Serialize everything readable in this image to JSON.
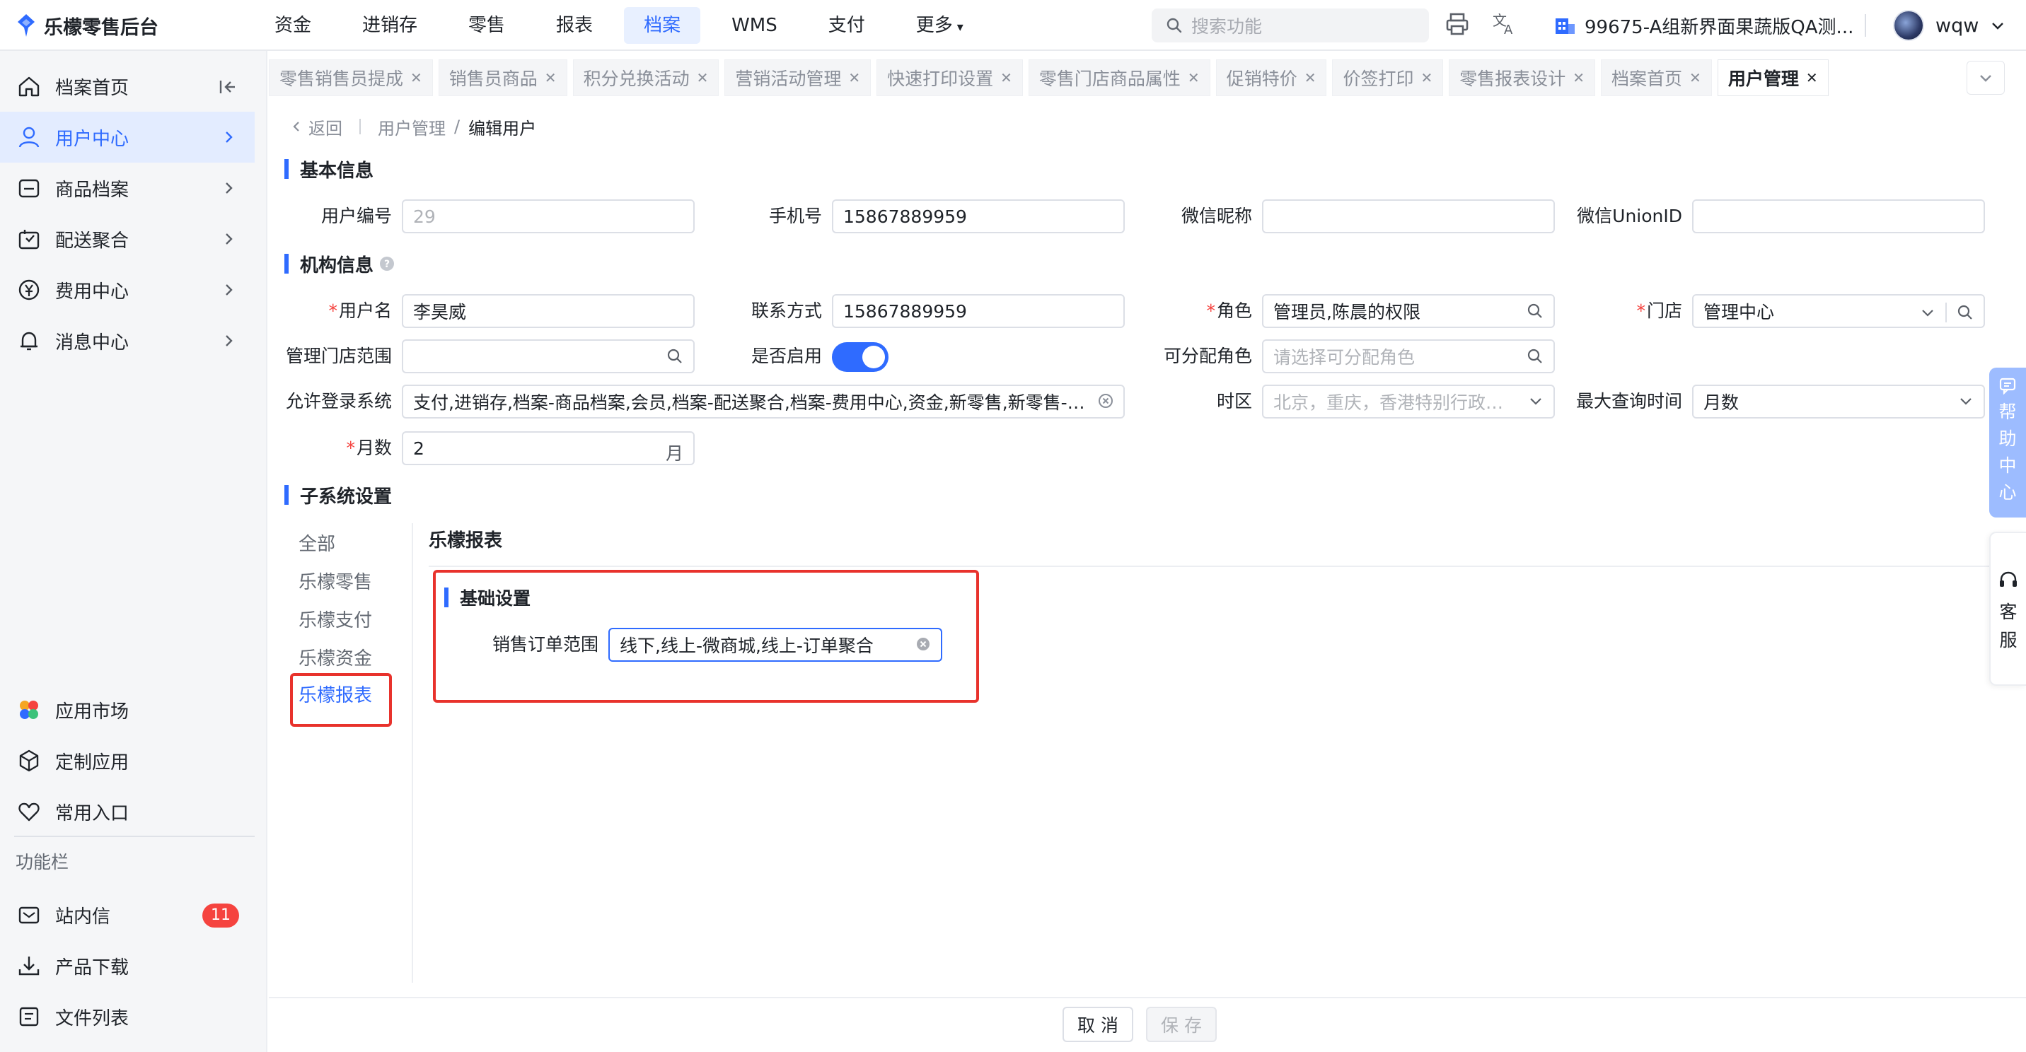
{
  "brand": {
    "name": "乐檬零售后台"
  },
  "topnav": {
    "items": [
      "资金",
      "进销存",
      "零售",
      "报表",
      "档案",
      "WMS",
      "支付",
      "更多"
    ],
    "active_index": 4
  },
  "search": {
    "placeholder": "搜索功能"
  },
  "org": {
    "name": "99675-A组新界面果蔬版QA测..."
  },
  "user": {
    "name": "wqw"
  },
  "sidebar": {
    "items": [
      {
        "label": "档案首页",
        "icon": "home-icon"
      },
      {
        "label": "用户中心",
        "icon": "user-icon"
      },
      {
        "label": "商品档案",
        "icon": "product-icon"
      },
      {
        "label": "配送聚合",
        "icon": "delivery-icon"
      },
      {
        "label": "费用中心",
        "icon": "yen-icon"
      },
      {
        "label": "消息中心",
        "icon": "bell-icon"
      }
    ],
    "bottom_items": [
      {
        "label": "应用市场",
        "icon": "app-market-icon"
      },
      {
        "label": "定制应用",
        "icon": "cube-icon"
      },
      {
        "label": "常用入口",
        "icon": "heart-icon"
      }
    ],
    "func_title": "功能栏",
    "func_items": [
      {
        "label": "站内信",
        "icon": "mail-icon",
        "badge": "11"
      },
      {
        "label": "产品下载",
        "icon": "download-icon"
      },
      {
        "label": "文件列表",
        "icon": "file-list-icon"
      }
    ]
  },
  "tabs": [
    "零售销售员提成",
    "销售员商品",
    "积分兑换活动",
    "营销活动管理",
    "快速打印设置",
    "零售门店商品属性",
    "促销特价",
    "价签打印",
    "零售报表设计",
    "档案首页",
    "用户管理"
  ],
  "breadcrumb": {
    "back": "返回",
    "parent": "用户管理",
    "sep": "/",
    "current": "编辑用户"
  },
  "sections": {
    "basic": "基本信息",
    "org": "机构信息",
    "subsystem": "子系统设置"
  },
  "basic": {
    "user_no_label": "用户编号",
    "user_no": "29",
    "phone_label": "手机号",
    "phone": "15867889959",
    "wechat_nick_label": "微信昵称",
    "wechat_nick": "",
    "wechat_union_label": "微信UnionID",
    "wechat_union": ""
  },
  "org_form": {
    "username_label": "用户名",
    "username": "李昊威",
    "contact_label": "联系方式",
    "contact": "15867889959",
    "role_label": "角色",
    "role": "管理员,陈晨的权限",
    "store_label": "门店",
    "store": "管理中心",
    "store_scope_label": "管理门店范围",
    "store_scope": "",
    "enabled_label": "是否启用",
    "enabled": true,
    "assignable_role_label": "可分配角色",
    "assignable_role_placeholder": "请选择可分配角色",
    "login_sys_label": "允许登录系统",
    "login_sys": "支付,进销存,档案-商品档案,会员,档案-配送聚合,档案-费用中心,资金,新零售,新零售-订单",
    "timezone_label": "时区",
    "timezone_placeholder": "北京，重庆，香港特别行政区...",
    "max_query_label": "最大查询时间",
    "max_query": "月数",
    "months_label": "月数",
    "months": "2",
    "months_unit": "月"
  },
  "subsystem": {
    "nav": [
      "全部",
      "乐檬零售",
      "乐檬支付",
      "乐檬资金",
      "乐檬报表"
    ],
    "active_index": 4,
    "panel_title": "乐檬报表",
    "basic_settings_title": "基础设置",
    "sales_order_scope_label": "销售订单范围",
    "sales_order_scope": "线下,线上-微商城,线上-订单聚合"
  },
  "footer": {
    "cancel": "取 消",
    "save": "保 存"
  },
  "float": {
    "help": [
      "帮",
      "助",
      "中",
      "心"
    ],
    "service": [
      "客",
      "服"
    ]
  },
  "colors": {
    "primary": "#2f6bff",
    "highlight_box": "#e8322c",
    "badge": "#f5433f"
  }
}
